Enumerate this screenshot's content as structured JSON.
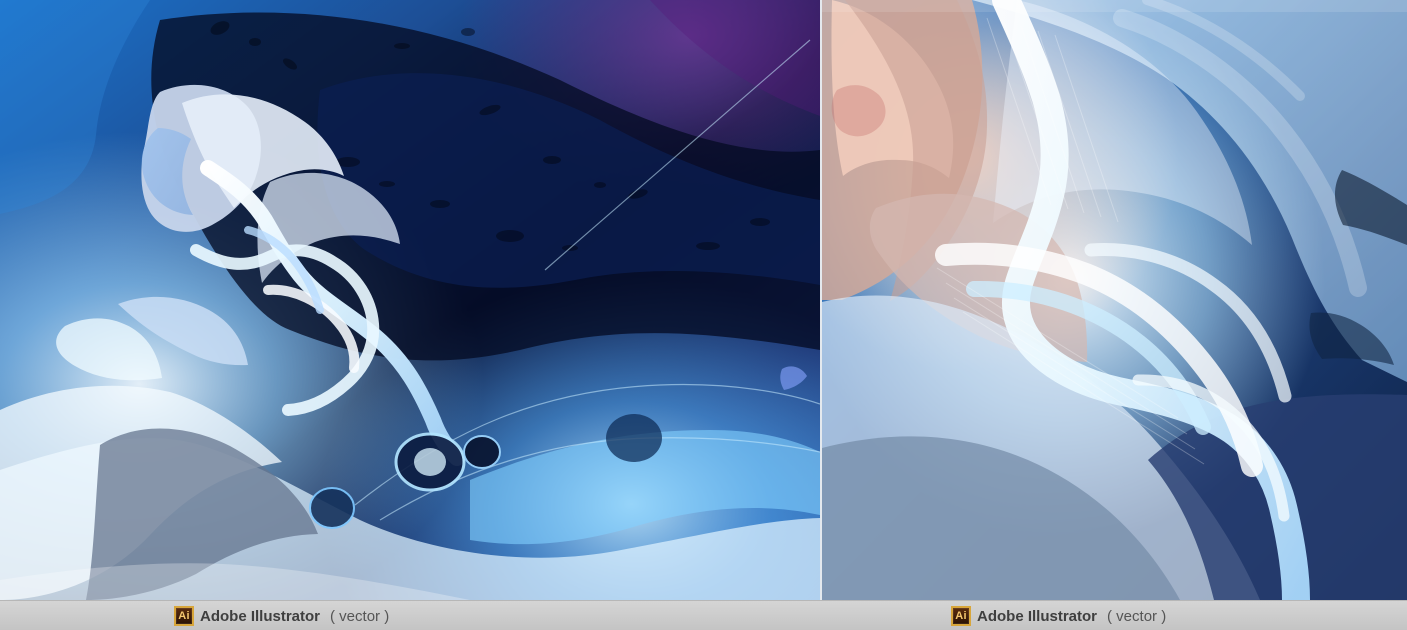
{
  "captions": {
    "left": {
      "icon": "ai-icon",
      "icon_text": "Ai",
      "title": "Adobe Illustrator",
      "subtitle": "( vector )"
    },
    "right": {
      "icon": "ai-icon",
      "icon_text": "Ai",
      "title": "Adobe Illustrator",
      "subtitle": "( vector )"
    }
  },
  "artwork": {
    "left_panel": {
      "icon": "illustration-icon",
      "accent_colors": [
        "#0d1840",
        "#1e63b7",
        "#9ed6ff",
        "#e6f3ff",
        "#39236d"
      ]
    },
    "right_panel": {
      "icon": "illustration-icon",
      "accent_colors": [
        "#1a4d8c",
        "#81c7ff",
        "#e7f4ff",
        "#d6b4a6",
        "#f3f8ff"
      ]
    }
  }
}
